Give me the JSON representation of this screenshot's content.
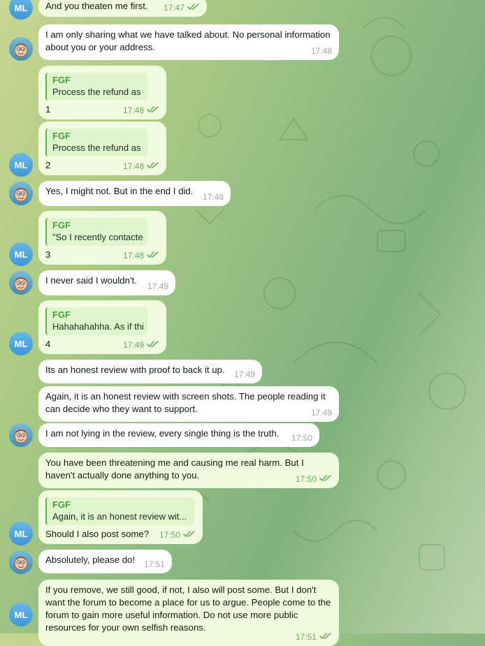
{
  "theme": {
    "accent": "#5fb046",
    "outgoing_bg": "#effdde",
    "incoming_bg": "#ffffff",
    "avatar_ml": "#4aa3e0"
  },
  "avatars": {
    "ml": "ML",
    "me_icon": "cartoon-face-icon"
  },
  "messages": [
    {
      "dir": "out",
      "text": "And you theaten me first.",
      "time": "17:47",
      "read": true
    },
    {
      "dir": "in",
      "text": "I am only sharing what we have talked about. No personal information about you or your address.",
      "time": "17:48"
    },
    {
      "dir": "out",
      "reply_name": "FGF",
      "reply_text": "Process the refund as ...",
      "text": "1",
      "time": "17:48",
      "read": true
    },
    {
      "dir": "out",
      "reply_name": "FGF",
      "reply_text": "Process the refund as ...",
      "text": "2",
      "time": "17:48",
      "read": true
    },
    {
      "dir": "in",
      "text": "Yes, I might not. But in the end I did.",
      "time": "17:48"
    },
    {
      "dir": "out",
      "reply_name": "FGF",
      "reply_text": "\"So I recently contacte...",
      "text": "3",
      "time": "17:48",
      "read": true
    },
    {
      "dir": "in",
      "text": "I never said I wouldn't.",
      "time": "17:49"
    },
    {
      "dir": "out",
      "reply_name": "FGF",
      "reply_text": "Hahahahahha. As if thi...",
      "text": "4",
      "time": "17:49",
      "read": true
    },
    {
      "dir": "in",
      "text": "Its an honest review with proof to back it up.",
      "time": "17:49"
    },
    {
      "dir": "in",
      "text": "Again, it is an honest review with screen shots. The people reading it can decide who they want to support.",
      "time": "17:49"
    },
    {
      "dir": "in",
      "text": "I am not lying in the review, every single thing is the truth.",
      "time": "17:50"
    },
    {
      "dir": "out",
      "text": "You have been threatening me and causing me real harm. But I haven't actually done anything to you.",
      "time": "17:50",
      "read": true
    },
    {
      "dir": "out",
      "reply_name": "FGF",
      "reply_text": "Again, it is an honest review wit...",
      "text": "Should I also post some?",
      "time": "17:50",
      "read": true
    },
    {
      "dir": "in",
      "text": "Absolutely, please do!",
      "time": "17:51"
    },
    {
      "dir": "out",
      "text": "If you remove, we still good, if not, I also will post some. But I don't want the forum to become a place for us to argue. People come to the forum to gain more useful information. Do not use more public resources for your own selfish reasons.",
      "time": "17:51",
      "read": true
    }
  ]
}
